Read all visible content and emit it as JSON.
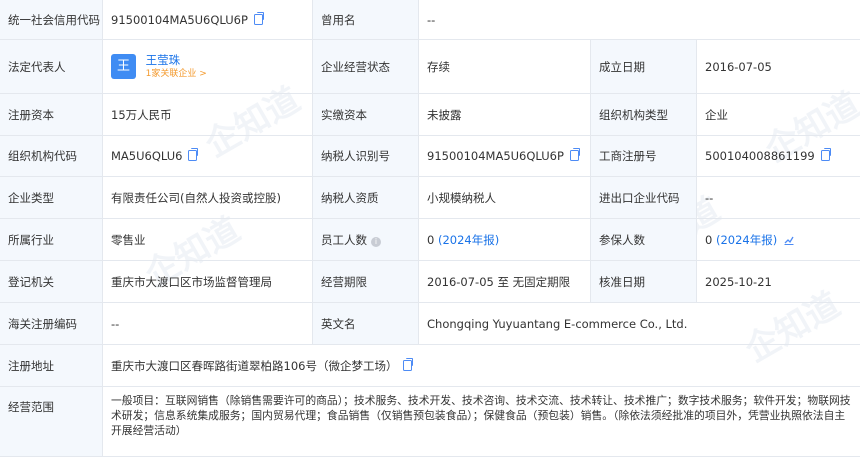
{
  "rows": {
    "credit_code": {
      "label": "统一社会信用代码",
      "value": "91500104MA5U6QLU6P"
    },
    "former_name": {
      "label": "曾用名",
      "value": "--"
    },
    "legal_rep": {
      "label": "法定代表人",
      "avatar_char": "王",
      "name": "王莹珠",
      "related": "1家关联企业 >"
    },
    "status": {
      "label": "企业经营状态",
      "value": "存续"
    },
    "est_date": {
      "label": "成立日期",
      "value": "2016-07-05"
    },
    "reg_capital": {
      "label": "注册资本",
      "value": "15万人民币"
    },
    "paid_capital": {
      "label": "实缴资本",
      "value": "未披露"
    },
    "org_type": {
      "label": "组织机构类型",
      "value": "企业"
    },
    "org_code": {
      "label": "组织机构代码",
      "value": "MA5U6QLU6"
    },
    "taxpayer_id": {
      "label": "纳税人识别号",
      "value": "91500104MA5U6QLU6P"
    },
    "biz_reg_no": {
      "label": "工商注册号",
      "value": "500104008861199"
    },
    "company_type": {
      "label": "企业类型",
      "value": "有限责任公司(自然人投资或控股)"
    },
    "taxpayer_qual": {
      "label": "纳税人资质",
      "value": "小规模纳税人"
    },
    "import_export": {
      "label": "进出口企业代码",
      "value": "--"
    },
    "industry": {
      "label": "所属行业",
      "value": "零售业"
    },
    "staff": {
      "label": "员工人数",
      "value": "0",
      "year": "(2024年报)"
    },
    "insured": {
      "label": "参保人数",
      "value": "0",
      "year": "(2024年报)"
    },
    "authority": {
      "label": "登记机关",
      "value": "重庆市大渡口区市场监督管理局"
    },
    "term": {
      "label": "经营期限",
      "value": "2016-07-05 至 无固定期限"
    },
    "approval_date": {
      "label": "核准日期",
      "value": "2025-10-21"
    },
    "customs_code": {
      "label": "海关注册编码",
      "value": "--"
    },
    "english_name": {
      "label": "英文名",
      "value": "Chongqing Yuyuantang E-commerce Co., Ltd."
    },
    "address": {
      "label": "注册地址",
      "value": "重庆市大渡口区春晖路街道翠柏路106号（微企梦工场）"
    },
    "scope": {
      "label": "经营范围",
      "value": "一般项目：互联网销售（除销售需要许可的商品）；技术服务、技术开发、技术咨询、技术交流、技术转让、技术推广；数字技术服务；软件开发；物联网技术研发；信息系统集成服务；国内贸易代理；食品销售（仅销售预包装食品）；保健食品（预包装）销售。（除依法须经批准的项目外，凭营业执照依法自主开展经营活动）"
    }
  },
  "watermark": "企知道",
  "colors": {
    "label_bg": "#f4f8fd",
    "border": "#e4e8ee",
    "accent": "#1a73e8",
    "orange": "#f39a2e"
  }
}
